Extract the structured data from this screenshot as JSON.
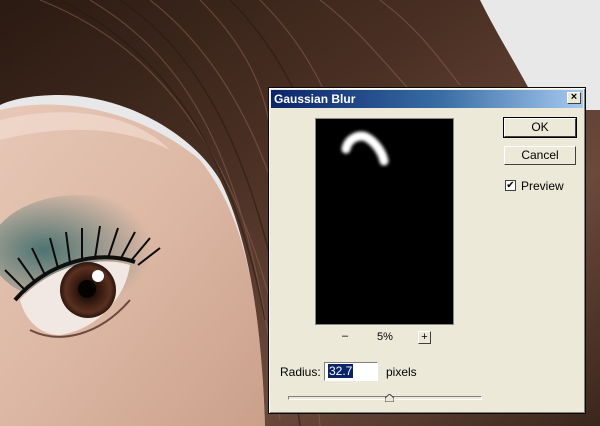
{
  "dialog": {
    "title": "Gaussian Blur",
    "close_glyph": "×",
    "ok_label": "OK",
    "cancel_label": "Cancel",
    "preview": {
      "label": "Preview",
      "checked": true,
      "check_glyph": "✔"
    },
    "zoom": {
      "minus_glyph": "–",
      "level": "5%",
      "plus_glyph": "+"
    },
    "radius": {
      "label": "Radius:",
      "value": "32.7",
      "unit": "pixels"
    },
    "slider": {
      "min_fraction": 0,
      "value_fraction": 0.52
    }
  },
  "colors": {
    "titlebar_start": "#0a246a",
    "titlebar_end": "#a6caf0",
    "dialog_face": "#ece9d8",
    "preview_bg": "#000000",
    "selection": "#0a246a"
  },
  "icons": [
    "close-icon",
    "checkmark-icon",
    "zoom-out-icon",
    "zoom-in-icon",
    "slider-thumb-icon"
  ]
}
